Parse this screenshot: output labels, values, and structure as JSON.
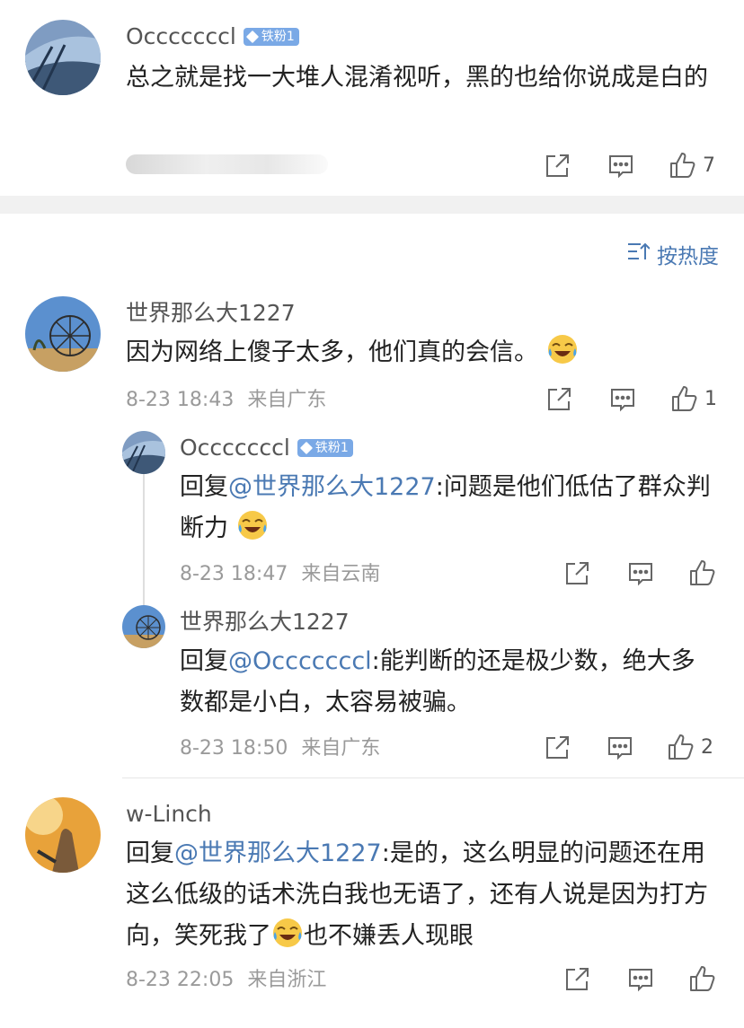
{
  "top_post": {
    "username": "Occcccccl",
    "badge": "铁粉1",
    "content": "总之就是找一大堆人混淆视听，黑的也给你说成是白的",
    "likes": "7"
  },
  "sort": {
    "label": "按热度"
  },
  "comments": [
    {
      "username": "世界那么大1227",
      "content": "因为网络上傻子太多，他们真的会信。",
      "time": "8-23 18:43",
      "location": "来自广东",
      "likes": "1",
      "replies": [
        {
          "username": "Occcccccl",
          "badge": "铁粉1",
          "reply_prefix": "回复",
          "mention": "@世界那么大1227",
          "content": ":问题是他们低估了群众判断力",
          "time": "8-23 18:47",
          "location": "来自云南",
          "likes": ""
        },
        {
          "username": "世界那么大1227",
          "reply_prefix": "回复",
          "mention": "@Occcccccl",
          "content": ":能判断的还是极少数，绝大多数都是小白，太容易被骗。",
          "time": "8-23 18:50",
          "location": "来自广东",
          "likes": "2"
        }
      ]
    },
    {
      "username": "w-Linch",
      "reply_prefix": "回复",
      "mention": "@世界那么大1227",
      "content_a": ":是的，这么明显的问题还在用这么低级的话术洗白我也无语了，还有人说是因为打方向，笑死我了",
      "content_b": "也不嫌丢人现眼",
      "time": "8-23 22:05",
      "location": "来自浙江",
      "likes": ""
    }
  ],
  "icons": {
    "share": "share-icon",
    "comment": "comment-icon",
    "like": "thumbs-up-icon",
    "sort": "sort-icon",
    "emoji": "laughing-crying-emoji"
  },
  "colors": {
    "link": "#4a79b3",
    "badge": "#7aa9e6",
    "meta": "#9a9a9a",
    "band": "#f1f1f1"
  }
}
